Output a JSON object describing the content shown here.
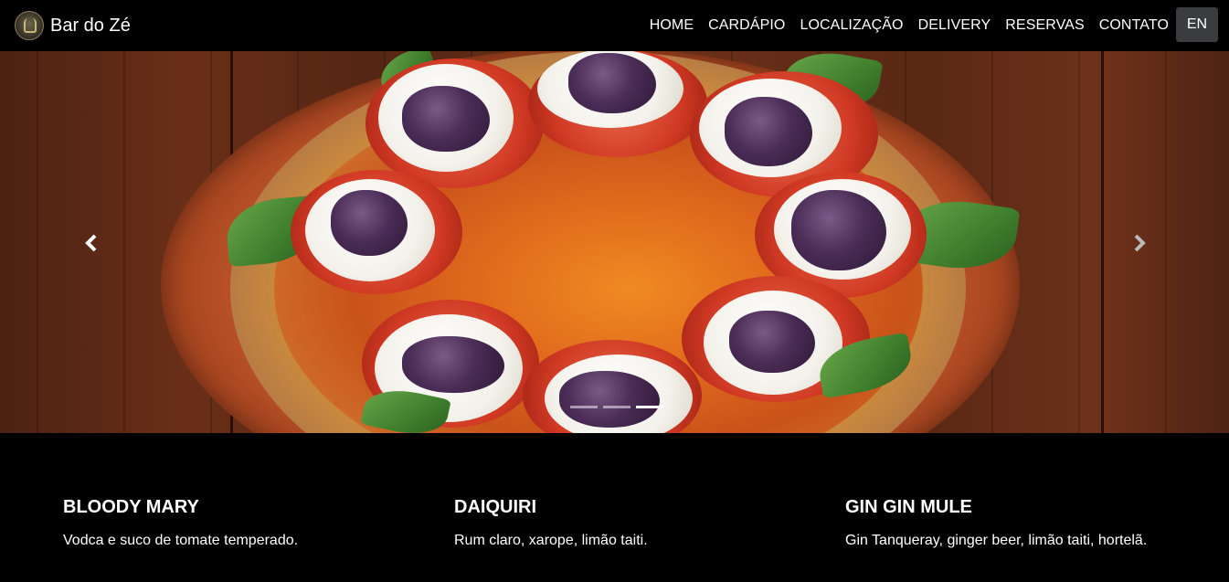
{
  "brand": {
    "name": "Bar do Zé",
    "logo": "bar-logo-icon"
  },
  "nav": {
    "items": [
      "HOME",
      "CARDÁPIO",
      "LOCALIZAÇÃO",
      "DELIVERY",
      "RESERVAS",
      "CONTATO"
    ],
    "language_button": "EN"
  },
  "carousel": {
    "image": "pizza-caprese-photo",
    "prev_icon": "chevron-left-icon",
    "next_icon": "chevron-right-icon",
    "slide_count": 3,
    "active_slide": 3
  },
  "drinks": [
    {
      "name": "BLOODY MARY",
      "description": "Vodca e suco de tomate temperado."
    },
    {
      "name": "DAIQUIRI",
      "description": "Rum claro, xarope, limão taiti."
    },
    {
      "name": "GIN GIN MULE",
      "description": "Gin Tanqueray, ginger beer, limão taiti, hortelã."
    }
  ],
  "colors": {
    "background": "#000000",
    "text": "#ffffff",
    "lang_button_bg": "#3a3c3f"
  }
}
